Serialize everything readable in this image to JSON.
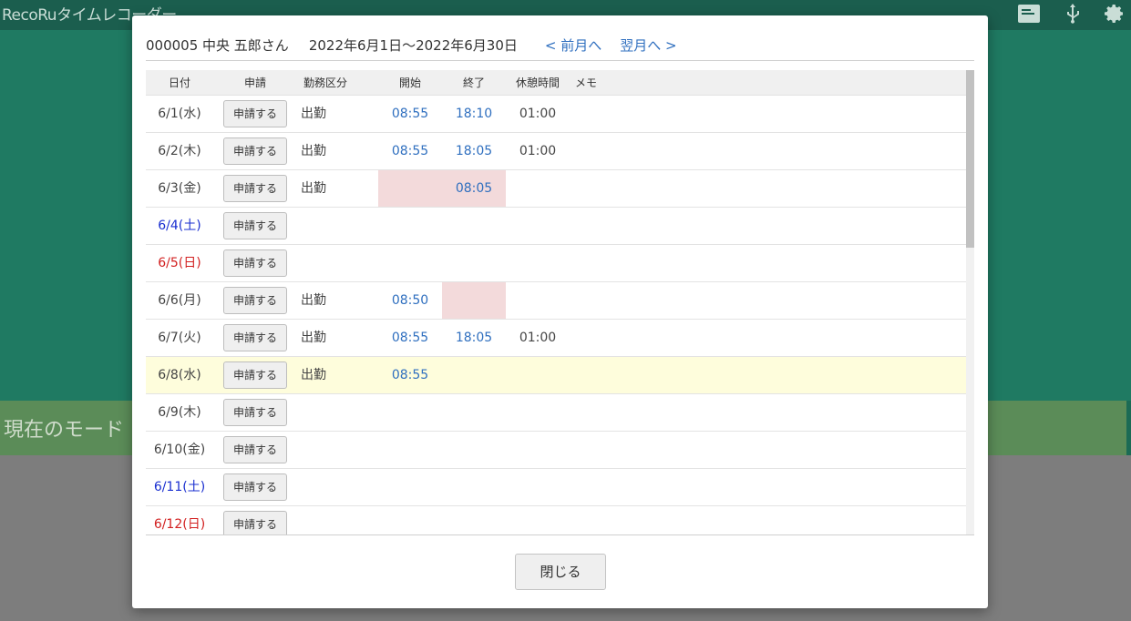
{
  "app": {
    "title": "RecoRuタイムレコーダー",
    "mode_label": "現在のモード",
    "header_icons": [
      "card-icon",
      "usb-icon",
      "gear-icon"
    ]
  },
  "modal": {
    "employee": "000005 中央 五郎さん",
    "period": "2022年6月1日〜2022年6月30日",
    "prev_label": "< 前月へ",
    "next_label": "翌月へ >",
    "close_label": "閉じる",
    "columns": [
      "日付",
      "申請",
      "勤務区分",
      "開始",
      "終了",
      "休憩時間",
      "メモ"
    ],
    "rows": [
      {
        "date": "6/1(水)",
        "day_type": "weekday",
        "request": "申請する",
        "type": "出勤",
        "start": "08:55",
        "end": "18:10",
        "break": "01:00",
        "memo": "",
        "missing_start": false,
        "missing_end": false,
        "today": false
      },
      {
        "date": "6/2(木)",
        "day_type": "weekday",
        "request": "申請する",
        "type": "出勤",
        "start": "08:55",
        "end": "18:05",
        "break": "01:00",
        "memo": "",
        "missing_start": false,
        "missing_end": false,
        "today": false
      },
      {
        "date": "6/3(金)",
        "day_type": "weekday",
        "request": "申請する",
        "type": "出勤",
        "start": "",
        "end": "08:05",
        "break": "",
        "memo": "",
        "missing_start": true,
        "missing_end": true,
        "today": false
      },
      {
        "date": "6/4(土)",
        "day_type": "saturday",
        "request": "申請する",
        "type": "",
        "start": "",
        "end": "",
        "break": "",
        "memo": "",
        "missing_start": false,
        "missing_end": false,
        "today": false
      },
      {
        "date": "6/5(日)",
        "day_type": "sunday",
        "request": "申請する",
        "type": "",
        "start": "",
        "end": "",
        "break": "",
        "memo": "",
        "missing_start": false,
        "missing_end": false,
        "today": false
      },
      {
        "date": "6/6(月)",
        "day_type": "weekday",
        "request": "申請する",
        "type": "出勤",
        "start": "08:50",
        "end": "",
        "break": "",
        "memo": "",
        "missing_start": false,
        "missing_end": true,
        "today": false
      },
      {
        "date": "6/7(火)",
        "day_type": "weekday",
        "request": "申請する",
        "type": "出勤",
        "start": "08:55",
        "end": "18:05",
        "break": "01:00",
        "memo": "",
        "missing_start": false,
        "missing_end": false,
        "today": false
      },
      {
        "date": "6/8(水)",
        "day_type": "weekday",
        "request": "申請する",
        "type": "出勤",
        "start": "08:55",
        "end": "",
        "break": "",
        "memo": "",
        "missing_start": false,
        "missing_end": false,
        "today": true
      },
      {
        "date": "6/9(木)",
        "day_type": "weekday",
        "request": "申請する",
        "type": "",
        "start": "",
        "end": "",
        "break": "",
        "memo": "",
        "missing_start": false,
        "missing_end": false,
        "today": false
      },
      {
        "date": "6/10(金)",
        "day_type": "weekday",
        "request": "申請する",
        "type": "",
        "start": "",
        "end": "",
        "break": "",
        "memo": "",
        "missing_start": false,
        "missing_end": false,
        "today": false
      },
      {
        "date": "6/11(土)",
        "day_type": "saturday",
        "request": "申請する",
        "type": "",
        "start": "",
        "end": "",
        "break": "",
        "memo": "",
        "missing_start": false,
        "missing_end": false,
        "today": false
      },
      {
        "date": "6/12(日)",
        "day_type": "sunday",
        "request": "申請する",
        "type": "",
        "start": "",
        "end": "",
        "break": "",
        "memo": "",
        "missing_start": false,
        "missing_end": false,
        "today": false
      }
    ]
  },
  "colors": {
    "link": "#2f6fbf",
    "saturday": "#1a2fd0",
    "sunday": "#d22020",
    "missing_cell": "#f3dadb",
    "today_row": "#fefddc"
  }
}
